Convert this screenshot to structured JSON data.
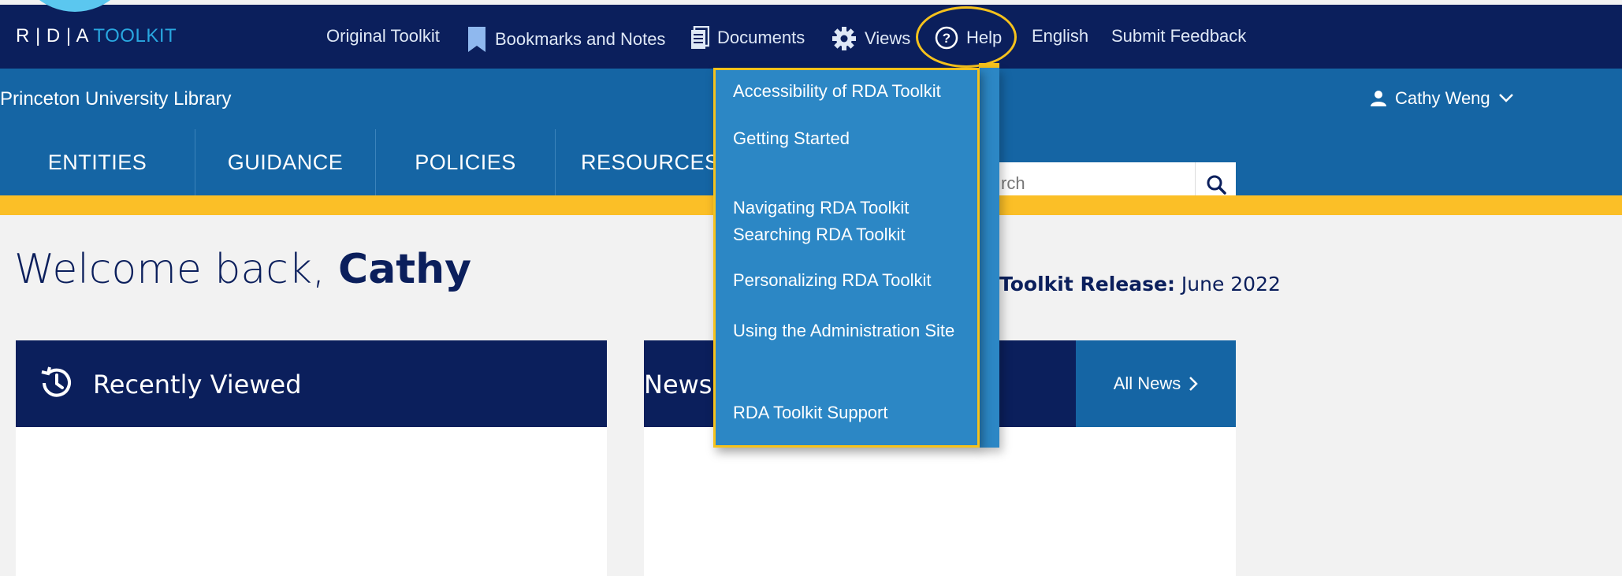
{
  "topbar": {
    "brand_main": "R | D | A",
    "brand_accent": "TOOLKIT",
    "links": {
      "original_toolkit": "Original Toolkit",
      "bookmarks": "Bookmarks and Notes",
      "documents": "Documents",
      "views": "Views",
      "help": "Help",
      "english": "English",
      "feedback": "Submit Feedback"
    }
  },
  "institution": {
    "name": "Princeton University Library",
    "user": "Cathy Weng"
  },
  "nav": {
    "items": [
      "ENTITIES",
      "GUIDANCE",
      "POLICIES",
      "RESOURCES"
    ]
  },
  "search": {
    "visible_text": "rch"
  },
  "welcome": {
    "prefix": "Welcome back, ",
    "name": "Cathy",
    "release_label": "Toolkit Release:",
    "release_value": " June 2022"
  },
  "cards": {
    "recent_title": "Recently Viewed",
    "news_title": "News",
    "all_news": "All News"
  },
  "help_menu": {
    "items": [
      "Accessibility of RDA Toolkit",
      "Getting Started",
      "Navigating RDA Toolkit",
      "Searching RDA Toolkit",
      "Personalizing RDA Toolkit",
      "Using the Administration Site",
      "RDA Toolkit Support"
    ]
  },
  "colors": {
    "navy": "#0b1f5c",
    "blue": "#1565a4",
    "menu_blue": "#2c87c5",
    "yellow": "#fbbf27",
    "highlight": "#f6c21c"
  }
}
